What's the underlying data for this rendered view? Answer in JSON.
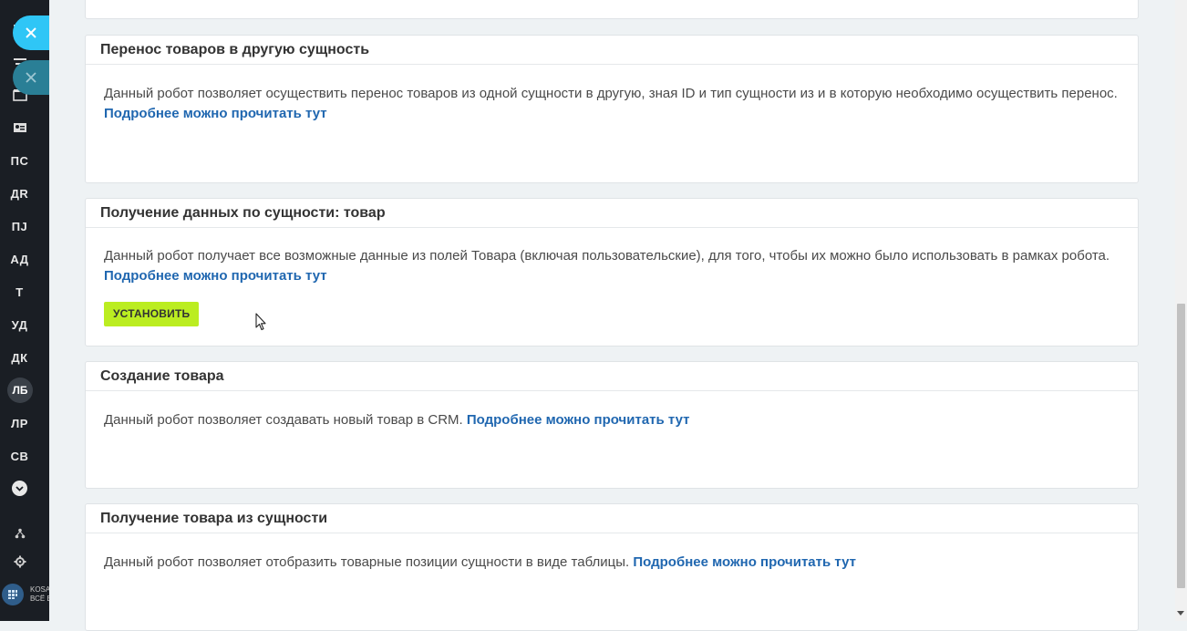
{
  "sidebar": {
    "items": [
      {
        "label": "ПС"
      },
      {
        "label": "ДR"
      },
      {
        "label": "ПJ"
      },
      {
        "label": "АД"
      },
      {
        "label": "Т"
      },
      {
        "label": "УД"
      },
      {
        "label": "ДК"
      },
      {
        "label": "ЛБ"
      },
      {
        "label": "ЛР"
      },
      {
        "label": "СВ"
      }
    ],
    "logo_text_1": "KOSA",
    "logo_text_2": "ВСЁ Б"
  },
  "cards": [
    {
      "title": "Перенос товаров в другую сущность",
      "description": "Данный робот позволяет осуществить перенос товаров из одной сущности в другую, зная ID и тип сущности из и в которую необходимо осуществить перенос.",
      "link": "Подробнее можно прочитать тут"
    },
    {
      "title": "Получение данных по сущности: товар",
      "description": "Данный робот получает все возможные данные из полей Товара (включая пользовательские), для того, чтобы их можно было использовать в рамках робота.",
      "link": "Подробнее можно прочитать тут",
      "button": "УСТАНОВИТЬ"
    },
    {
      "title": "Создание товара",
      "description": "Данный робот позволяет создавать новый товар в CRM.",
      "link": "Подробнее можно прочитать тут"
    },
    {
      "title": "Получение товара из сущности",
      "description": "Данный робот позволяет отобразить товарные позиции сущности в виде таблицы.",
      "link": "Подробнее можно прочитать тут"
    }
  ],
  "colors": {
    "accent_link": "#2067b0",
    "install_button": "#bbed21",
    "close_button": "#2fc6f6"
  }
}
